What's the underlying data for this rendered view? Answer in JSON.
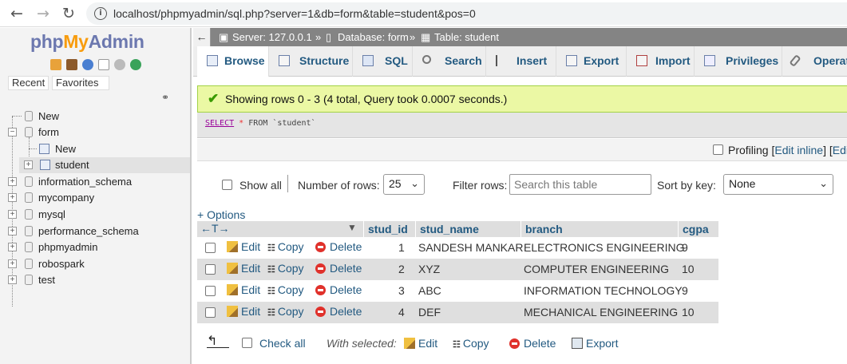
{
  "browser": {
    "url": "localhost/phpmyadmin/sql.php?server=1&db=form&table=student&pos=0"
  },
  "sidebar": {
    "logo": {
      "php": "php",
      "my": "My",
      "admin": "Admin"
    },
    "recent_label": "Recent",
    "favorites_label": "Favorites",
    "tree": {
      "new_top": "New",
      "form": "form",
      "form_new": "New",
      "student": "student",
      "dbs": [
        "information_schema",
        "mycompany",
        "mysql",
        "performance_schema",
        "phpmyadmin",
        "robospark",
        "test"
      ]
    }
  },
  "breadcrumb": {
    "server": "Server: 127.0.0.1",
    "sep": "»",
    "database": "Database: form",
    "table": "Table: student"
  },
  "tabs": [
    "Browse",
    "Structure",
    "SQL",
    "Search",
    "Insert",
    "Export",
    "Import",
    "Privileges",
    "Operat"
  ],
  "message": "Showing rows 0 - 3 (4 total, Query took 0.0007 seconds.)",
  "query": {
    "select": "SELECT",
    "star": "*",
    "from": "FROM",
    "table": "`student`"
  },
  "profiling": {
    "label": "Profiling",
    "edit_inline": "Edit inline",
    "edit": "Edit"
  },
  "controls": {
    "show_all": "Show all",
    "number_of_rows": "Number of rows:",
    "rows_value": "25",
    "filter_rows": "Filter rows:",
    "filter_placeholder": "Search this table",
    "sort_by_key": "Sort by key:",
    "sort_value": "None"
  },
  "options_link": "+ Options",
  "table": {
    "columns": [
      "stud_id",
      "stud_name",
      "branch",
      "cgpa"
    ],
    "actions": {
      "edit": "Edit",
      "copy": "Copy",
      "delete": "Delete"
    },
    "rows": [
      {
        "stud_id": "1",
        "stud_name": "SANDESH MANKAR",
        "branch": "ELECTRONICS ENGINEERING",
        "cgpa": "9"
      },
      {
        "stud_id": "2",
        "stud_name": "XYZ",
        "branch": "COMPUTER ENGINEERING",
        "cgpa": "10"
      },
      {
        "stud_id": "3",
        "stud_name": "ABC",
        "branch": "INFORMATION TECHNOLOGY",
        "cgpa": "9"
      },
      {
        "stud_id": "4",
        "stud_name": "DEF",
        "branch": "MECHANICAL ENGINEERING",
        "cgpa": "10"
      }
    ]
  },
  "bottom": {
    "check_all": "Check all",
    "with_selected": "With selected:",
    "edit": "Edit",
    "copy": "Copy",
    "delete": "Delete",
    "export": "Export"
  }
}
